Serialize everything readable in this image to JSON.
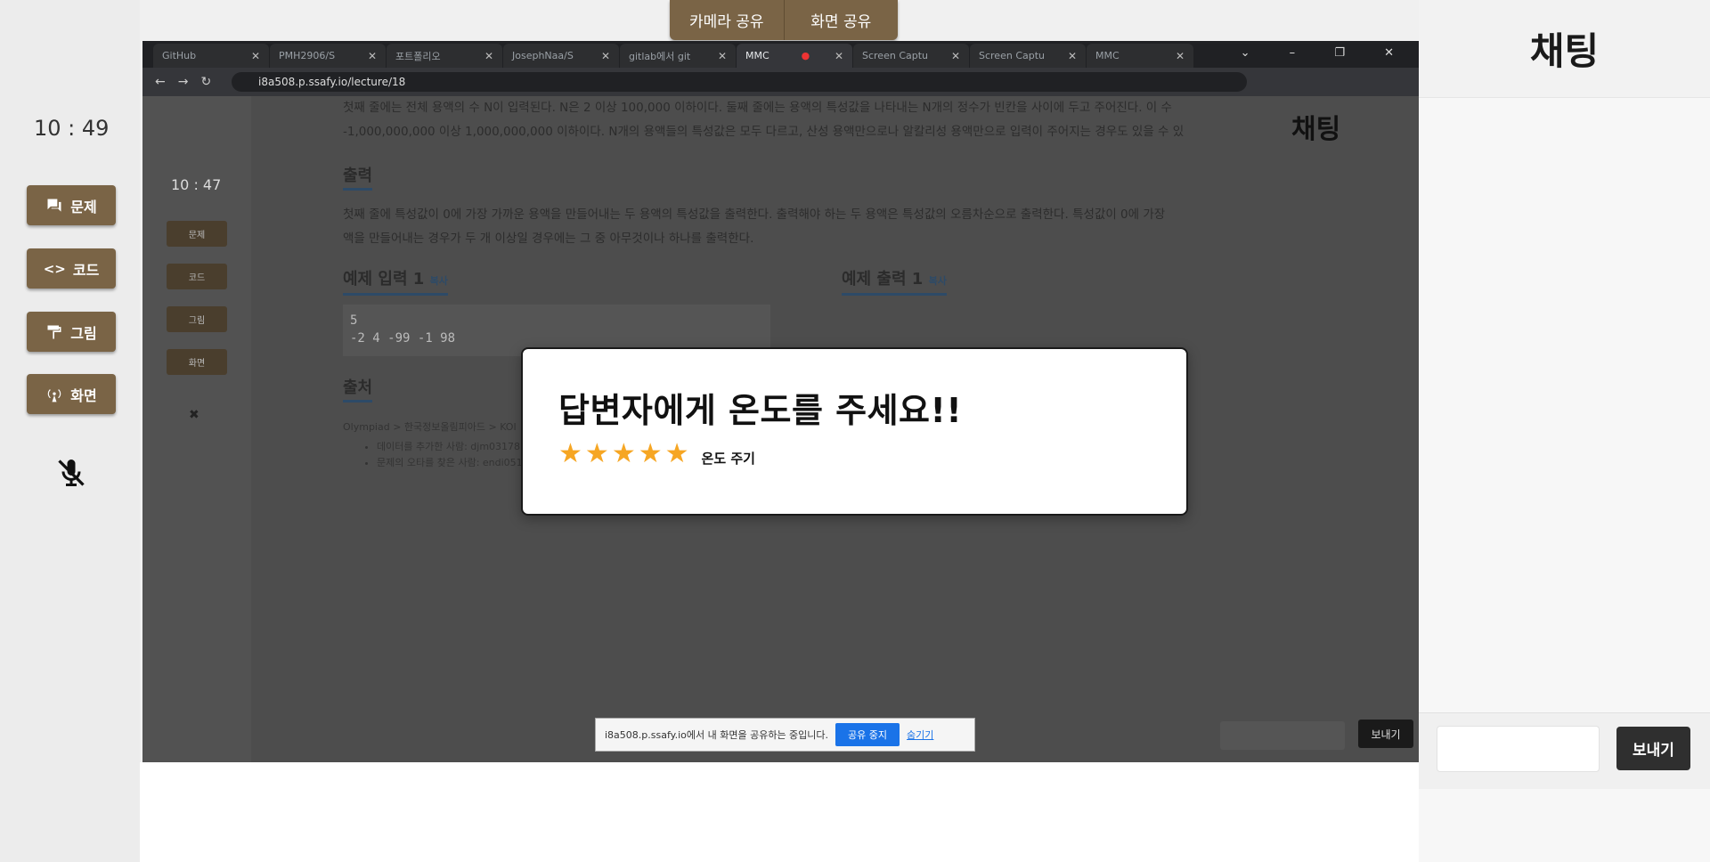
{
  "share_bar": {
    "camera": "카메라 공유",
    "screen": "화면 공유"
  },
  "sidebar": {
    "clock": "10 : 49",
    "buttons": [
      {
        "label": "문제",
        "icon": "chat-icon"
      },
      {
        "label": "코드",
        "icon": "code-icon"
      },
      {
        "label": "그림",
        "icon": "paint-roller-icon"
      },
      {
        "label": "화면",
        "icon": "broadcast-icon"
      }
    ],
    "mic_icon": "mic-off-icon"
  },
  "chat": {
    "title": "채팅",
    "input_placeholder": "",
    "send_label": "보내기"
  },
  "browser": {
    "tabs": [
      "GitHub",
      "PMH2906/S",
      "포트폴리오",
      "JosephNaa/S",
      "gitlab에서 git",
      "MMC",
      "Screen Captu",
      "Screen Captu",
      "MMC"
    ],
    "active_tab_index": 5,
    "url": "i8a508.p.ssafy.io/lecture/18"
  },
  "shared_page": {
    "clock": "10 : 47",
    "buttons": [
      "문제",
      "코드",
      "그림",
      "화면"
    ],
    "chat_title": "채팅",
    "intro_line1": "첫째 줄에는 전체 용액의 수 N이 입력된다. N은 2 이상 100,000 이하이다. 둘째 줄에는 용액의 특성값을 나타내는 N개의 정수가 빈칸을 사이에 두고 주어진다. 이 수",
    "intro_line2": "-1,000,000,000 이상 1,000,000,000 이하이다. N개의 용액들의 특성값은 모두 다르고, 산성 용액만으로나 알칼리성 용액만으로 입력이 주어지는 경우도 있을 수 있",
    "output_heading": "출력",
    "output_line1": "첫째 줄에 특성값이 0에 가장 가까운 용액을 만들어내는 두 용액의 특성값을 출력한다. 출력해야 하는 두 용액은 특성값의 오름차순으로 출력한다. 특성값이 0에 가장",
    "output_line2": "액을 만들어내는 경우가 두 개 이상일 경우에는 그 중 아무것이나 하나를 출력한다.",
    "sample_input_heading": "예제 입력 1",
    "sample_output_heading": "예제 출력 1",
    "copy_label": "복사",
    "sample_input_line1": "5",
    "sample_input_line2": "-2 4 -99 -1 98",
    "source_heading": "출처",
    "source_line": "Olympiad > 한국정보올림피아드 > KOI",
    "source_item1": "데이터를 추가한 사람: djm03178",
    "source_item2": "문제의 오타를 찾은 사람: endi0513",
    "notice_text": "i8a508.p.ssafy.io에서 내 화면을 공유하는 중입니다.",
    "notice_stop": "공유 중지",
    "notice_hide": "숨기기",
    "send_label": "보내기"
  },
  "modal": {
    "title": "답변자에게 온도를 주세요!!",
    "rating": 5,
    "rating_max": 5,
    "rate_label": "온도 주기",
    "star_color": "#f6a623"
  },
  "colors": {
    "accent_brown": "#7a6446",
    "send_dark": "#2f2f2f"
  }
}
